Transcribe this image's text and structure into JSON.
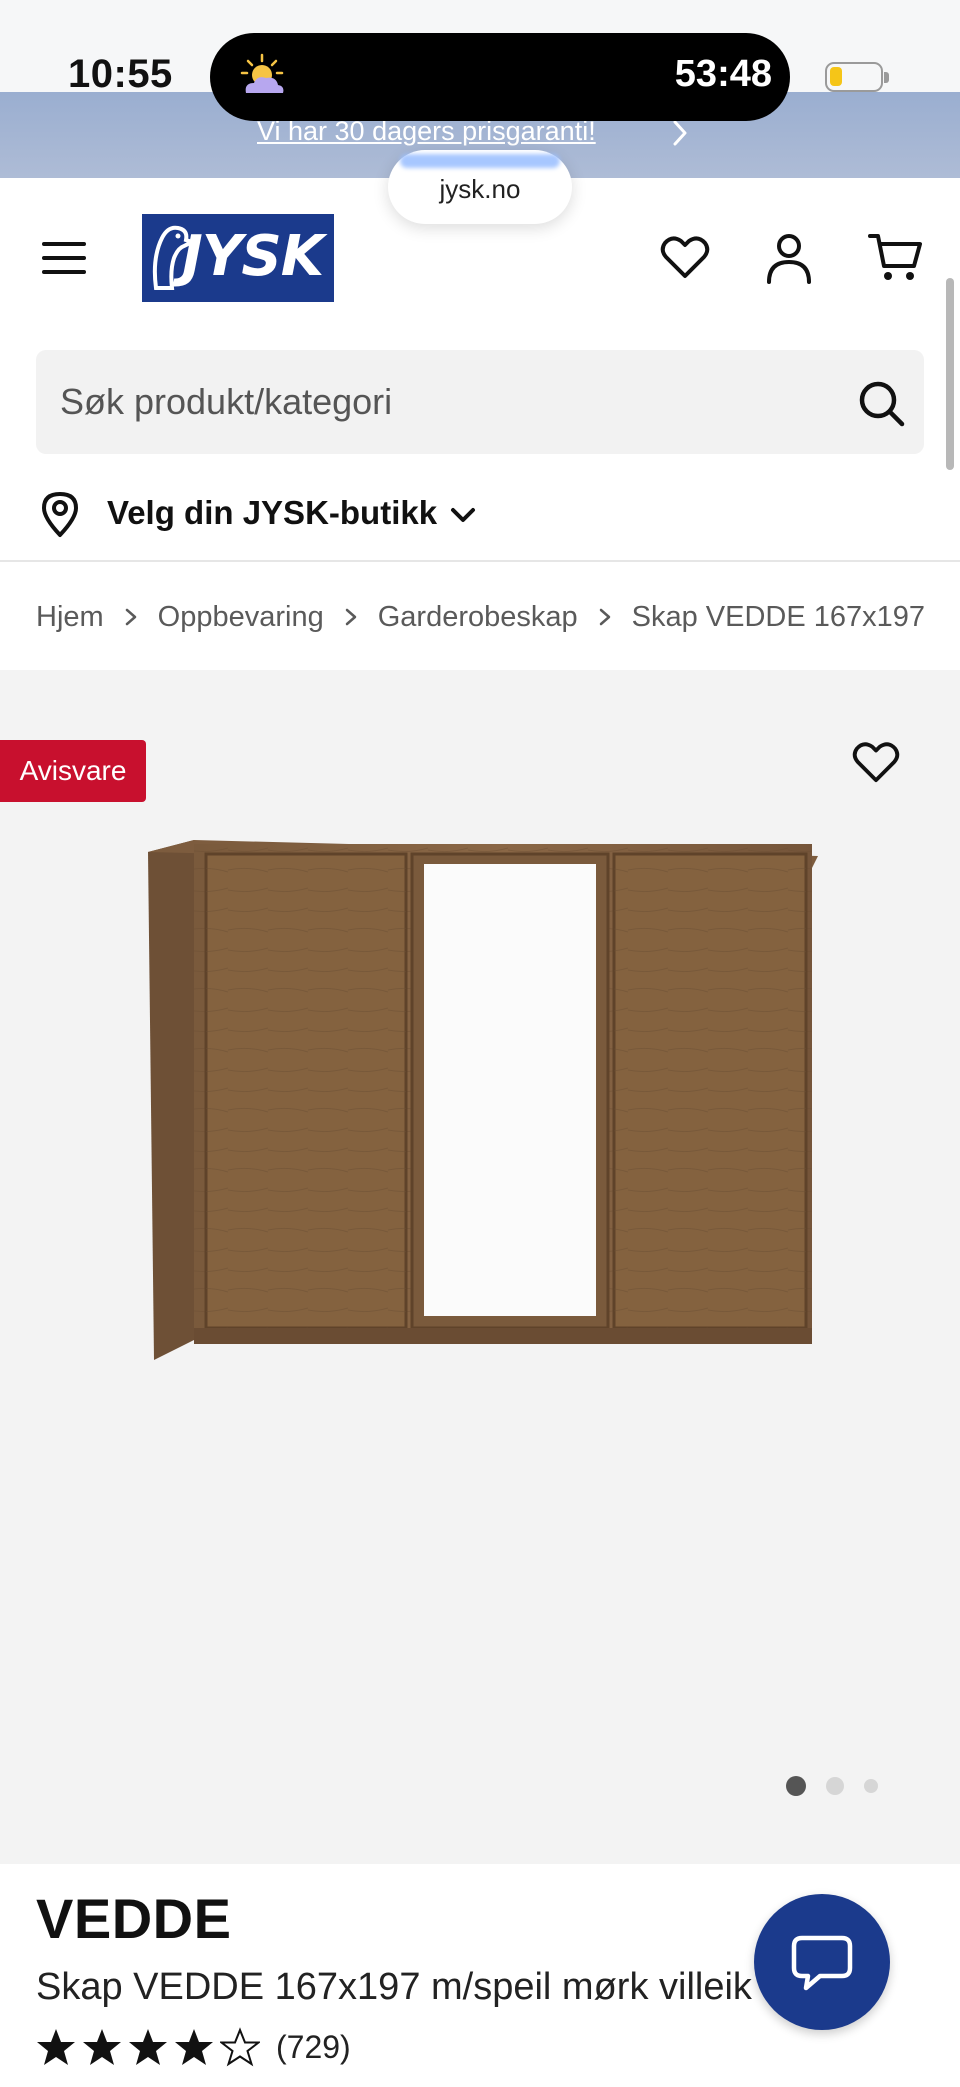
{
  "status_bar": {
    "time": "10:55",
    "timer": "53:48",
    "battery_level": 0.25,
    "weather_icon": "night-cloud-icon"
  },
  "promo": {
    "text": "Vi har 30 dagers prisgaranti!"
  },
  "browser": {
    "url": "jysk.no"
  },
  "header": {
    "logo_text": "JYSK",
    "brand_color": "#1b3a8c",
    "icons": [
      "menu-icon",
      "heart-icon",
      "user-icon",
      "cart-icon"
    ]
  },
  "search": {
    "placeholder": "Søk produkt/kategori"
  },
  "store": {
    "label": "Velg din JYSK-butikk"
  },
  "breadcrumb": [
    "Hjem",
    "Oppbevaring",
    "Garderobeskap",
    "Skap VEDDE 167x197"
  ],
  "gallery": {
    "badge": "Avisvare",
    "badge_color": "#c8102e",
    "slide_count": 3,
    "active_slide": 1
  },
  "product": {
    "brand": "VEDDE",
    "name": "Skap VEDDE 167x197 m/speil mørk villeik",
    "rating": 4,
    "rating_max": 5,
    "review_count": "(729)"
  }
}
